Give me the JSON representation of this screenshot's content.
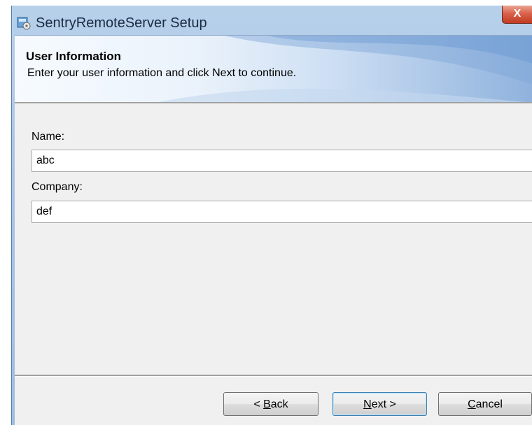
{
  "window": {
    "title": "SentryRemoteServer Setup",
    "close_label": "X"
  },
  "header": {
    "title": "User Information",
    "subtitle": "Enter your user information and click Next to continue."
  },
  "form": {
    "name_label": "Name:",
    "name_value": "abc",
    "company_label": "Company:",
    "company_value": "def"
  },
  "buttons": {
    "back": {
      "prefix": "< ",
      "mnemonic": "B",
      "rest": "ack"
    },
    "next": {
      "mnemonic": "N",
      "rest": "ext >"
    },
    "cancel": {
      "mnemonic": "C",
      "rest": "ancel"
    }
  },
  "icons": {
    "app": "installer-icon",
    "close": "close-icon"
  },
  "colors": {
    "titlebar": "#a9c5e4",
    "close_button": "#d9634b",
    "content_bg": "#f0f0f0",
    "default_button_border": "#3c7fb1"
  }
}
